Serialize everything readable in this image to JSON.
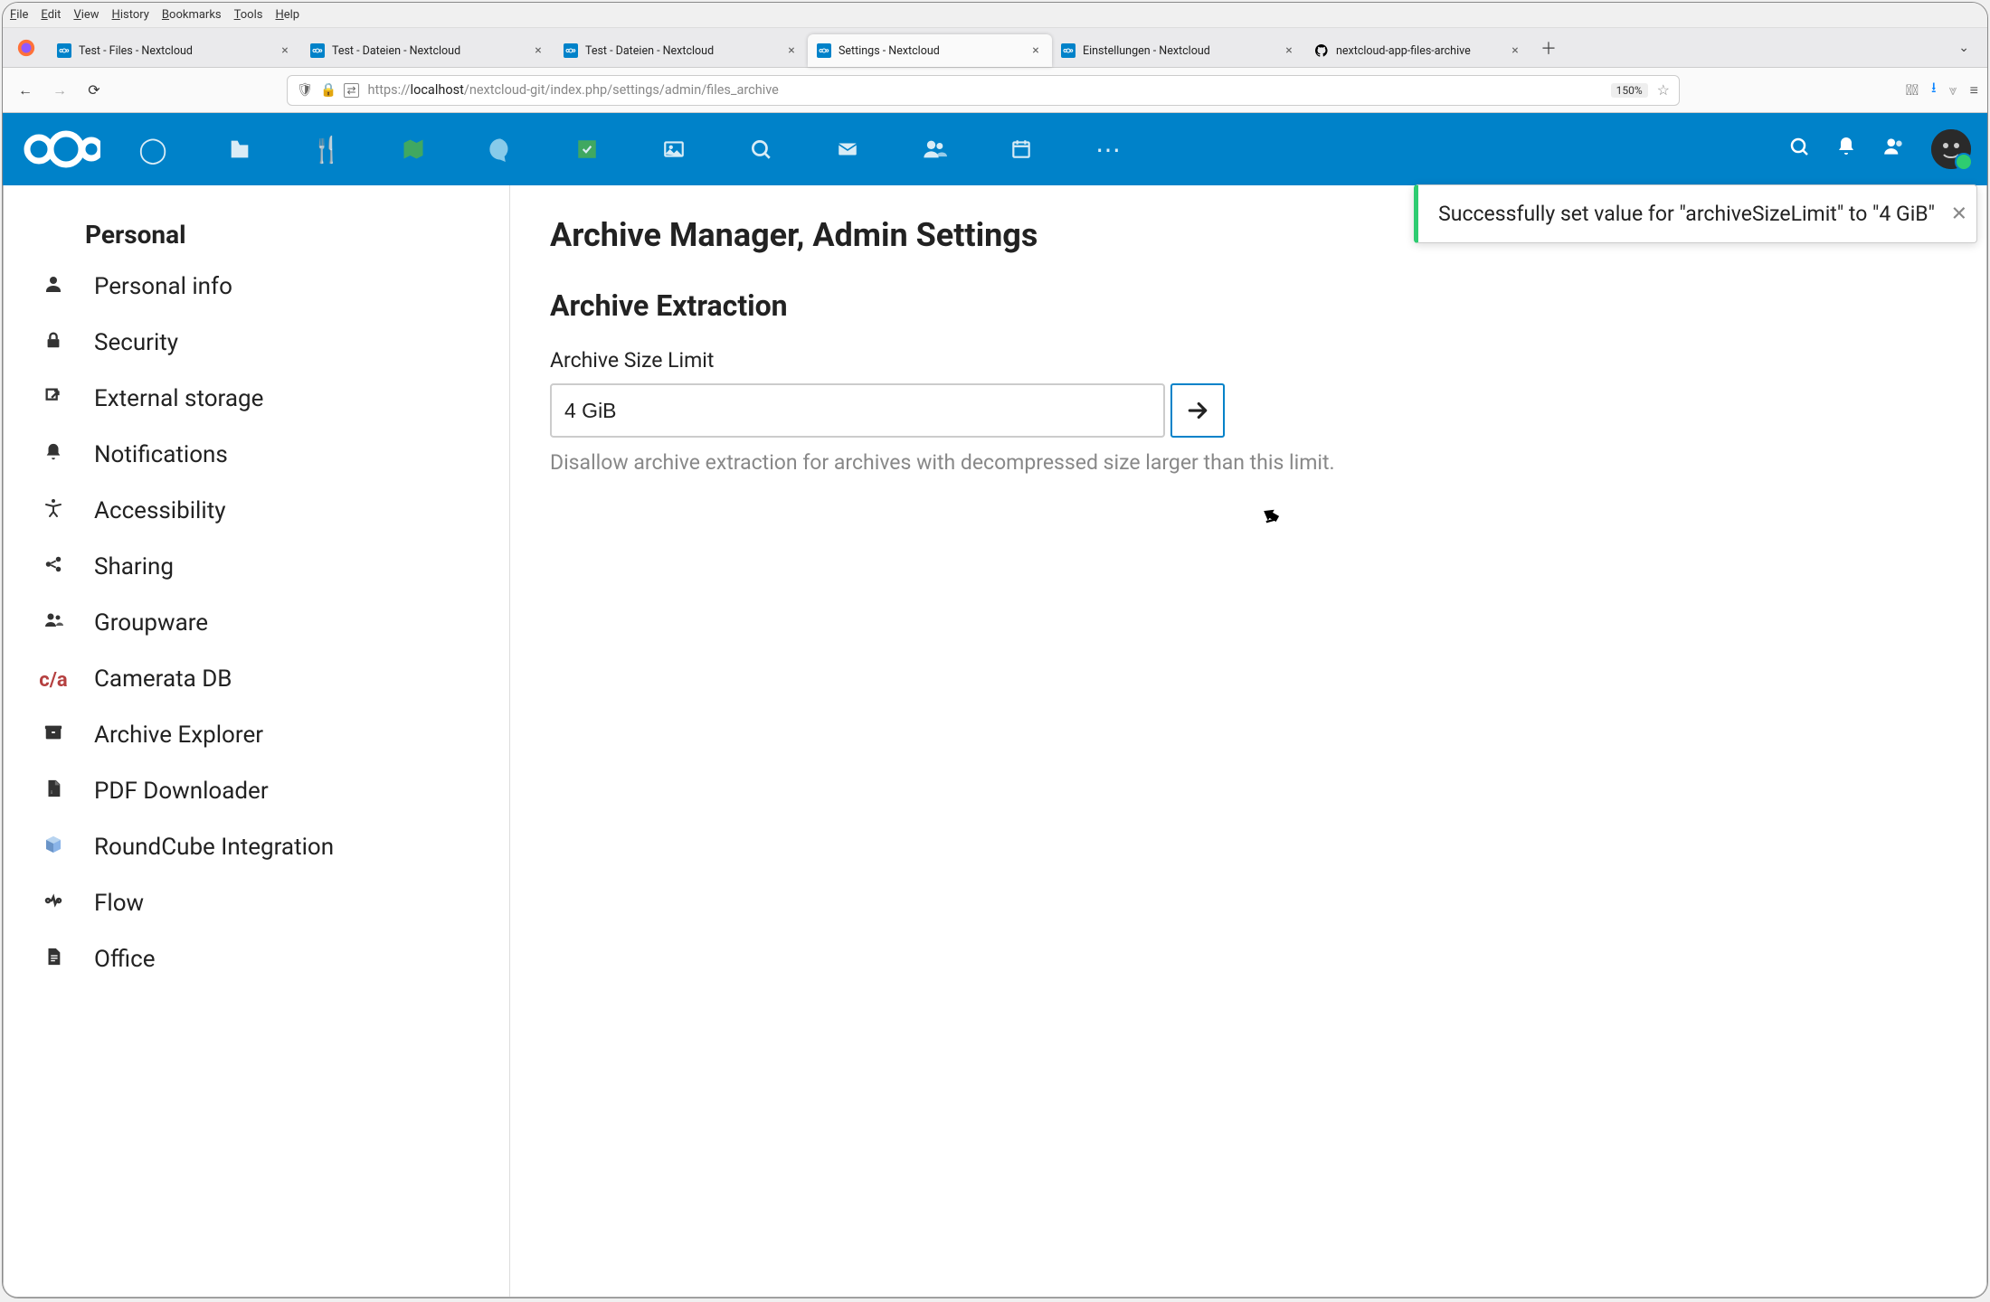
{
  "os_menu": [
    "File",
    "Edit",
    "View",
    "History",
    "Bookmarks",
    "Tools",
    "Help"
  ],
  "tabs": [
    {
      "title": "Test - Files - Nextcloud",
      "fav": "nc"
    },
    {
      "title": "Test - Dateien - Nextcloud",
      "fav": "nc"
    },
    {
      "title": "Test - Dateien - Nextcloud",
      "fav": "nc"
    },
    {
      "title": "Settings - Nextcloud",
      "fav": "nc",
      "active": true
    },
    {
      "title": "Einstellungen - Nextcloud",
      "fav": "nc"
    },
    {
      "title": "nextcloud-app-files-archive",
      "fav": "gh"
    }
  ],
  "url": {
    "prefix": "https://",
    "host": "localhost",
    "path": "/nextcloud-git/index.php/settings/admin/files_archive"
  },
  "zoom": "150%",
  "sidebar": {
    "heading": "Personal",
    "items": [
      {
        "icon": "user",
        "label": "Personal info"
      },
      {
        "icon": "lock",
        "label": "Security"
      },
      {
        "icon": "ext",
        "label": "External storage"
      },
      {
        "icon": "bell",
        "label": "Notifications"
      },
      {
        "icon": "a11y",
        "label": "Accessibility"
      },
      {
        "icon": "share",
        "label": "Sharing"
      },
      {
        "icon": "group",
        "label": "Groupware"
      },
      {
        "icon": "cdb",
        "label": "Camerata DB"
      },
      {
        "icon": "archive",
        "label": "Archive Explorer"
      },
      {
        "icon": "pdf",
        "label": "PDF Downloader"
      },
      {
        "icon": "cube",
        "label": "RoundCube Integration"
      },
      {
        "icon": "flow",
        "label": "Flow"
      },
      {
        "icon": "doc",
        "label": "Office"
      }
    ]
  },
  "main": {
    "title": "Archive Manager, Admin Settings",
    "section": "Archive Extraction",
    "field_label": "Archive Size Limit",
    "field_value": "4 GiB",
    "field_help": "Disallow archive extraction for archives with decompressed size larger than this limit."
  },
  "toast": "Successfully set value for \"archiveSizeLimit\" to \"4 GiB\""
}
